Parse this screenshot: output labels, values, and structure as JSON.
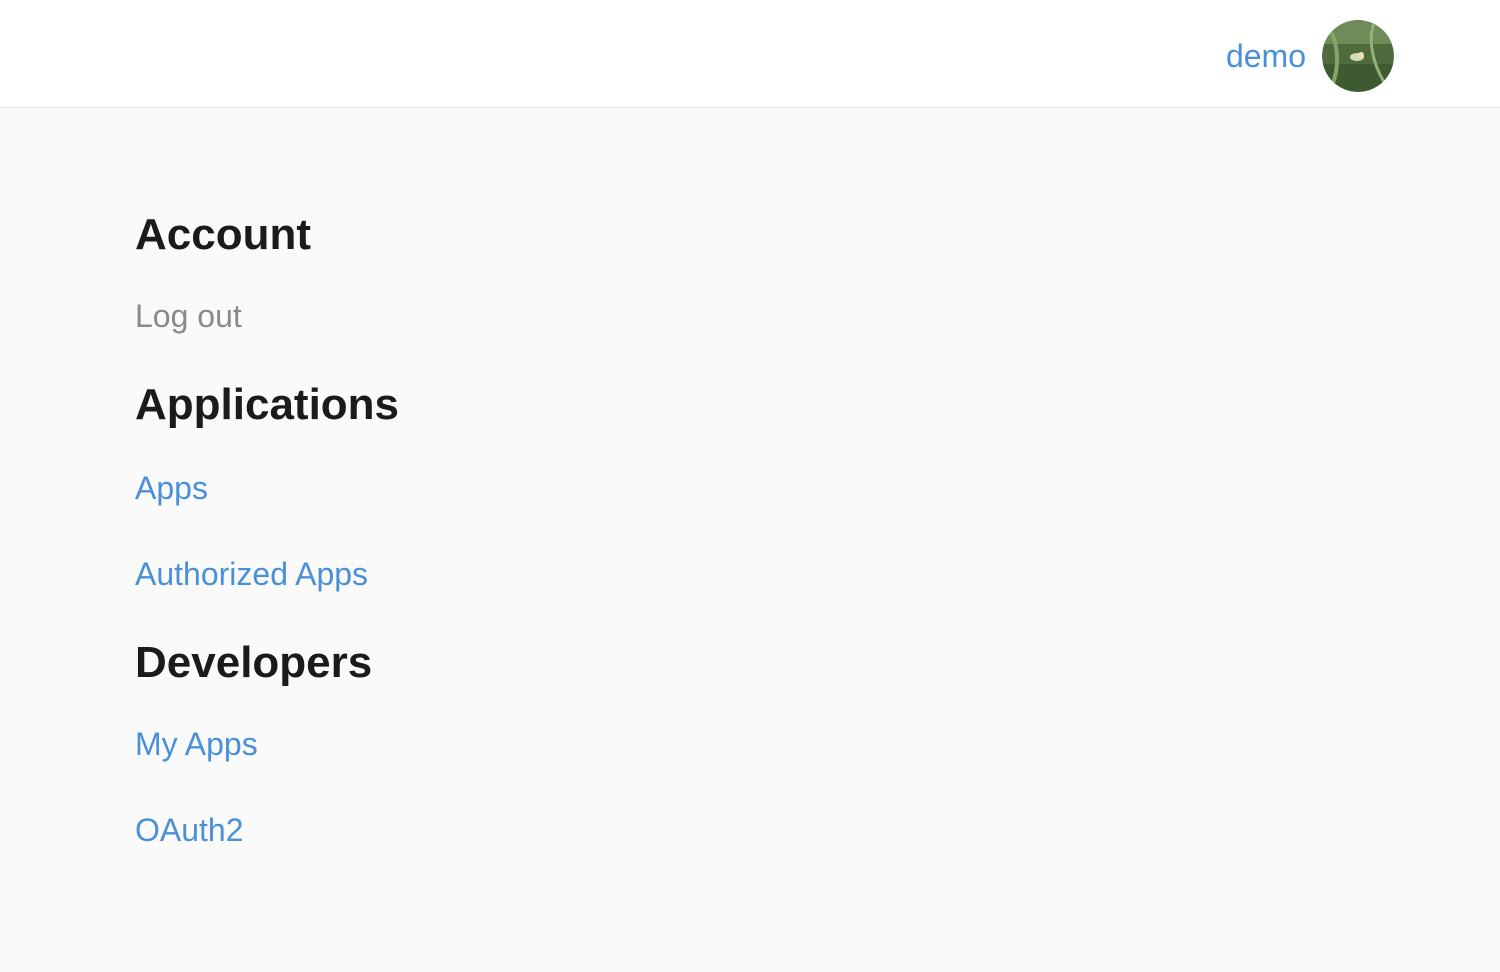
{
  "header": {
    "username": "demo",
    "avatar_icon": "user-avatar-photo"
  },
  "sections": {
    "account": {
      "title": "Account",
      "items": [
        "Log out"
      ]
    },
    "applications": {
      "title": "Applications",
      "items": [
        "Apps",
        "Authorized Apps"
      ]
    },
    "developers": {
      "title": "Developers",
      "items": [
        "My Apps",
        "OAuth2"
      ]
    }
  },
  "colors": {
    "link": "#4a90d9",
    "muted": "#8a8a8a",
    "heading": "#1b1b1b",
    "background": "#fafafa",
    "header_background": "#ffffff"
  }
}
